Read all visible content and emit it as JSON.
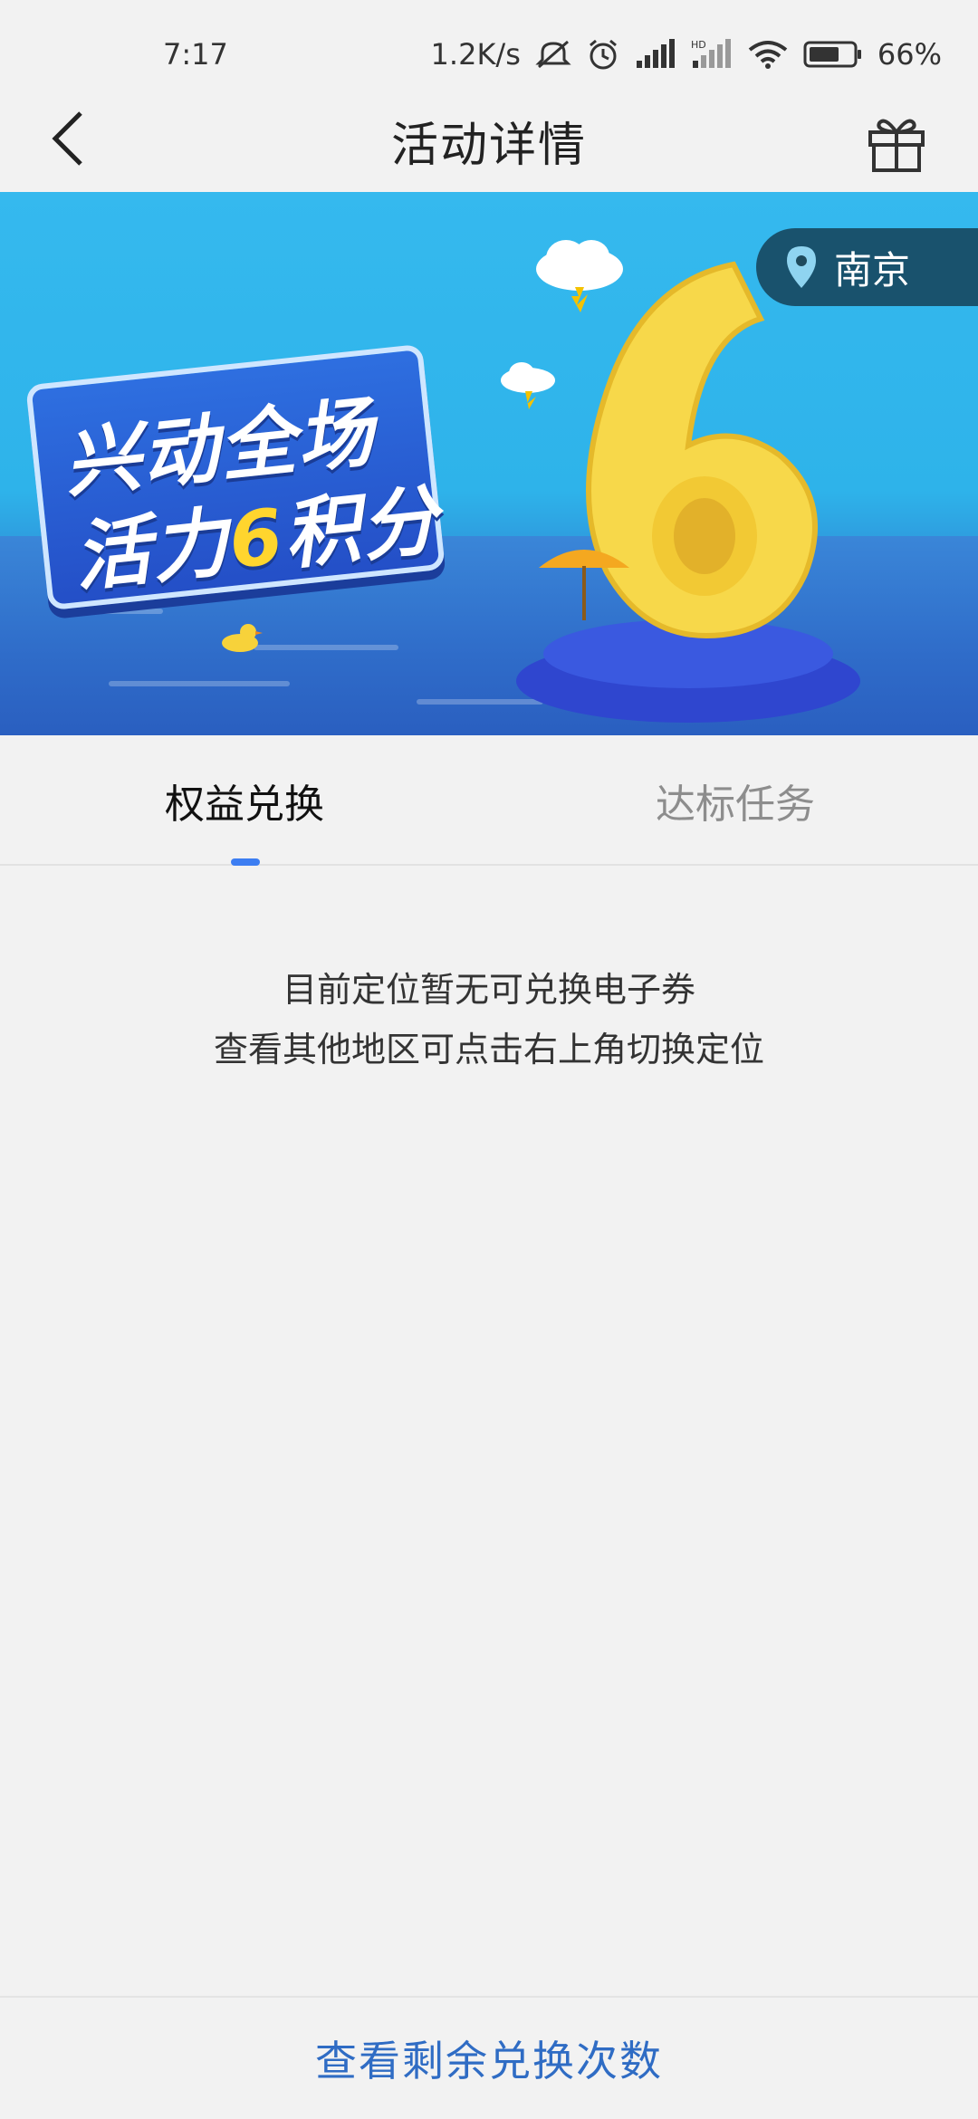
{
  "status_bar": {
    "time": "7:17",
    "net_speed": "1.2K/s",
    "battery": "66%",
    "icons": [
      "mute-icon",
      "alarm-icon",
      "signal-icon",
      "hd-signal-icon",
      "wifi-icon",
      "battery-icon"
    ]
  },
  "header": {
    "title": "活动详情",
    "back_icon": "chevron-left-icon",
    "gift_icon": "gift-icon"
  },
  "banner": {
    "title_line1": "兴动全场",
    "title_line2_prefix": "活力",
    "title_line2_number": "6",
    "title_line2_suffix": "积分",
    "big_number": "6",
    "location": "南京",
    "location_icon": "location-pin-icon"
  },
  "tabs": [
    {
      "label": "权益兑换",
      "active": true
    },
    {
      "label": "达标任务",
      "active": false
    }
  ],
  "empty_state": {
    "line1": "目前定位暂无可兑换电子券",
    "line2": "查看其他地区可点击右上角切换定位"
  },
  "bottom": {
    "link_label": "查看剩余兑换次数"
  },
  "colors": {
    "accent": "#3d7ef2",
    "link": "#2f6cc4",
    "banner_sky": "#35b9ee",
    "six_yellow": "#ffd52e"
  }
}
